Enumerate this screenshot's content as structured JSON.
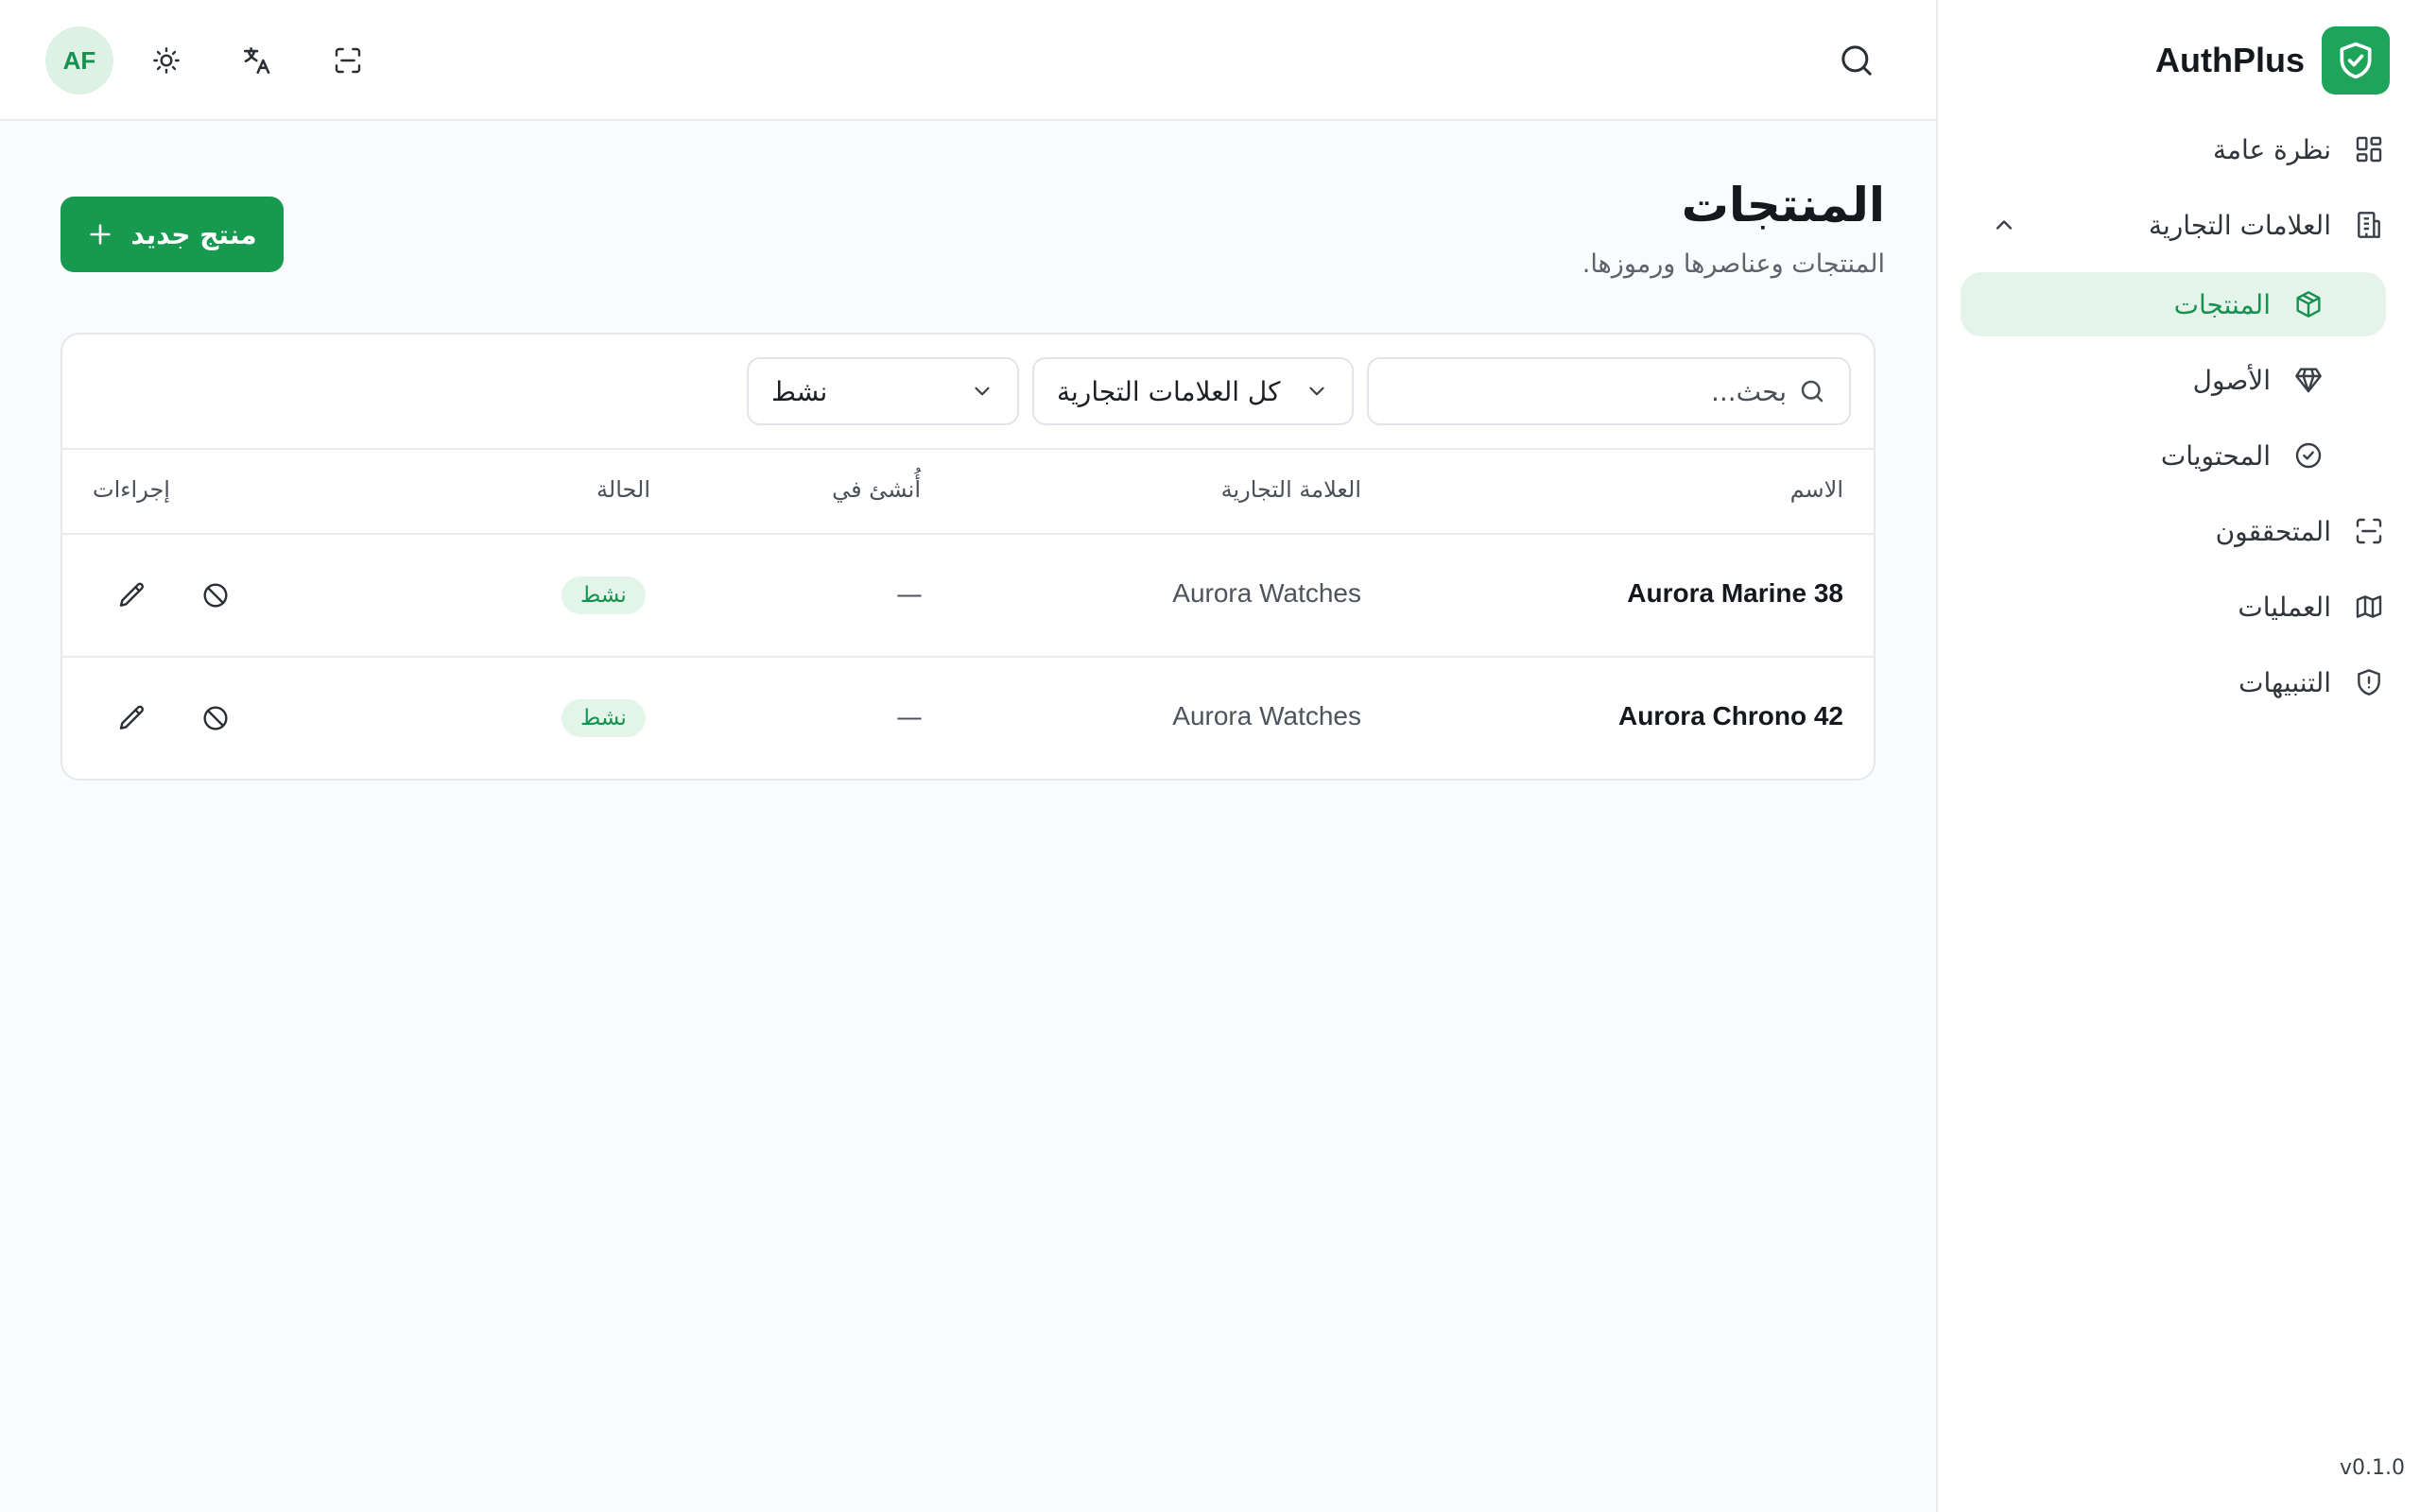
{
  "brand": {
    "name": "AuthPlus"
  },
  "sidebar": {
    "items": [
      {
        "label": "نظرة عامة",
        "icon": "grid-icon"
      },
      {
        "label": "العلامات التجارية",
        "icon": "building-icon"
      },
      {
        "label": "المنتجات",
        "icon": "box-icon"
      },
      {
        "label": "الأصول",
        "icon": "diamond-icon"
      },
      {
        "label": "المحتويات",
        "icon": "check-circle-icon"
      },
      {
        "label": "المتحققون",
        "icon": "scan-icon"
      },
      {
        "label": "العمليات",
        "icon": "map-icon"
      },
      {
        "label": "التنبيهات",
        "icon": "shield-alert-icon"
      }
    ],
    "version": "v0.1.0"
  },
  "topbar": {
    "avatar_initials": "AF"
  },
  "page": {
    "title": "المنتجات",
    "subtitle": "المنتجات وعناصرها ورموزها.",
    "new_button": "منتج جديد"
  },
  "filters": {
    "search_placeholder": "بحث...",
    "brand_select": "كل العلامات التجارية",
    "status_select": "نشط"
  },
  "table": {
    "headers": {
      "name": "الاسم",
      "brand": "العلامة التجارية",
      "created": "أُنشئ في",
      "status": "الحالة",
      "actions": "إجراءات"
    },
    "rows": [
      {
        "name": "Aurora Marine 38",
        "brand": "Aurora Watches",
        "created": "—",
        "status": "نشط"
      },
      {
        "name": "Aurora Chrono 42",
        "brand": "Aurora Watches",
        "created": "—",
        "status": "نشط"
      }
    ]
  },
  "colors": {
    "accent": "#17994f",
    "accent_light": "#e5f4ea"
  }
}
